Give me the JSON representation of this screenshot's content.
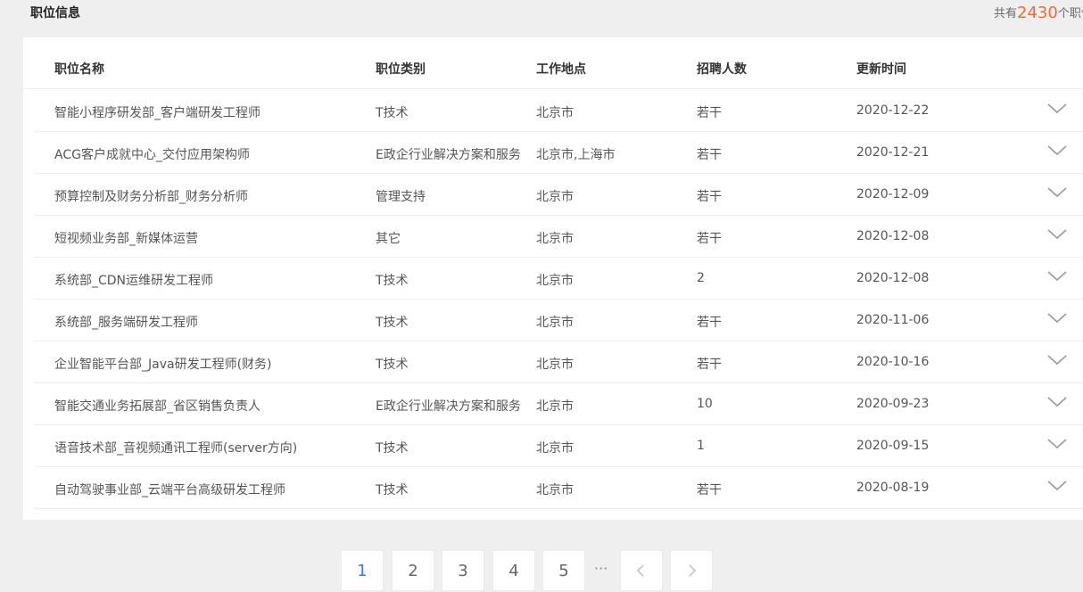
{
  "section": {
    "title": "职位信息",
    "summary_prefix": "共有",
    "summary_count": "2430",
    "summary_suffix": "个职位"
  },
  "table": {
    "headers": [
      "职位名称",
      "职位类别",
      "工作地点",
      "招聘人数",
      "更新时间"
    ],
    "rows": [
      [
        "智能小程序研发部_客户端研发工程师",
        "T技术",
        "北京市",
        "若干",
        "2020-12-22"
      ],
      [
        "ACG客户成就中心_交付应用架构师",
        "E政企行业解决方案和服务",
        "北京市,上海市",
        "若干",
        "2020-12-21"
      ],
      [
        "预算控制及财务分析部_财务分析师",
        "管理支持",
        "北京市",
        "若干",
        "2020-12-09"
      ],
      [
        "短视频业务部_新媒体运营",
        "其它",
        "北京市",
        "若干",
        "2020-12-08"
      ],
      [
        "系统部_CDN运维研发工程师",
        "T技术",
        "北京市",
        "2",
        "2020-12-08"
      ],
      [
        "系统部_服务端研发工程师",
        "T技术",
        "北京市",
        "若干",
        "2020-11-06"
      ],
      [
        "企业智能平台部_Java研发工程师(财务)",
        "T技术",
        "北京市",
        "若干",
        "2020-10-16"
      ],
      [
        "智能交通业务拓展部_省区销售负责人",
        "E政企行业解决方案和服务",
        "北京市",
        "10",
        "2020-09-23"
      ],
      [
        "语音技术部_音视频通讯工程师(server方向)",
        "T技术",
        "北京市",
        "1",
        "2020-09-15"
      ],
      [
        "自动驾驶事业部_云端平台高级研发工程师",
        "T技术",
        "北京市",
        "若干",
        "2020-08-19"
      ]
    ],
    "row_action_icon": "chevron-down-icon"
  },
  "pagination": {
    "pages": [
      "1",
      "2",
      "3",
      "4",
      "5"
    ],
    "current": "1",
    "ellipsis": "···",
    "prev_icon": "chevron-left-icon",
    "next_icon": "chevron-right-icon"
  },
  "colors": {
    "accent_count": "#f06a3a",
    "active_page": "#3a7bd5",
    "background": "#efefef"
  }
}
